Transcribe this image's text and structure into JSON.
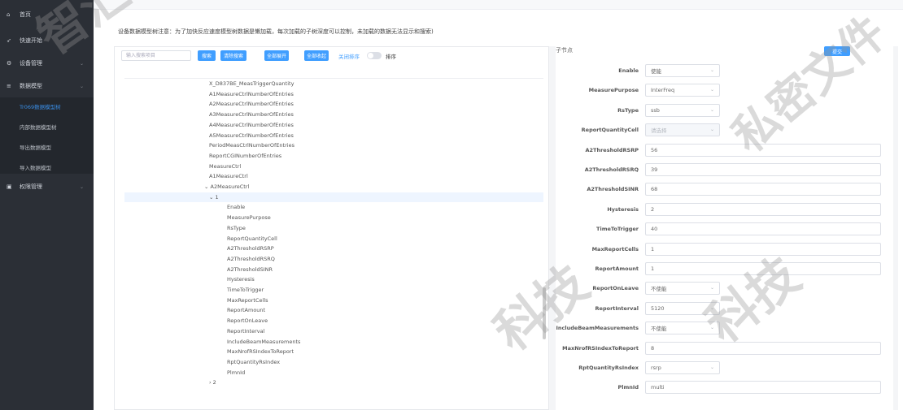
{
  "sidebar": {
    "items": [
      {
        "icon": "home-icon",
        "glyph": "⌂",
        "label": "首页"
      },
      {
        "icon": "rocket-icon",
        "glyph": "➶",
        "label": "快速开始"
      },
      {
        "icon": "gear-icon",
        "glyph": "⚙",
        "label": "设备管理"
      },
      {
        "icon": "list-icon",
        "glyph": "≡",
        "label": "数据模型"
      },
      {
        "icon": "id-card-icon",
        "glyph": "▣",
        "label": "权限管理"
      }
    ],
    "chevron": "⌄",
    "submenu": [
      "Tr069数据模型树",
      "内部数据模型树",
      "导出数据模型",
      "导入数据模型"
    ]
  },
  "notice": "设备数据模型树注意：为了加快反应速度模型树数据是懒加载，每次加载的子树深度可以控制，未加载的数据无法显示和搜索)",
  "toolbar": {
    "search_placeholder": "输入搜索项目",
    "search_btn": "搜索",
    "clear_btn": "清除搜索",
    "expand_btn": "全部展开",
    "collapse_btn": "全部收起",
    "close_sort": "关闭排序",
    "sort": "排序"
  },
  "tree": {
    "rows": [
      {
        "text": "X_D837BE_MeasTriggerQuantity"
      },
      {
        "text": "A1MeasureCtrlNumberOfEntries"
      },
      {
        "text": "A2MeasureCtrlNumberOfEntries"
      },
      {
        "text": "A3MeasureCtrlNumberOfEntries"
      },
      {
        "text": "A4MeasureCtrlNumberOfEntries"
      },
      {
        "text": "A5MeasureCtrlNumberOfEntries"
      },
      {
        "text": "PeriodMeasCtrlNumberOfEntries"
      },
      {
        "text": "ReportCGINumberOfEntries"
      },
      {
        "text": "MeasureCtrl"
      },
      {
        "text": "A1MeasureCtrl"
      },
      {
        "text": "⌄ A2MeasureCtrl"
      },
      {
        "text": "⌄ 1"
      },
      {
        "text": "Enable"
      },
      {
        "text": "MeasurePurpose"
      },
      {
        "text": "RsType"
      },
      {
        "text": "ReportQuantityCell"
      },
      {
        "text": "A2ThresholdRSRP"
      },
      {
        "text": "A2ThresholdRSRQ"
      },
      {
        "text": "A2ThresholdSINR"
      },
      {
        "text": "Hysteresis"
      },
      {
        "text": "TimeToTrigger"
      },
      {
        "text": "MaxReportCells"
      },
      {
        "text": "ReportAmount"
      },
      {
        "text": "ReportOnLeave"
      },
      {
        "text": "ReportInterval"
      },
      {
        "text": "IncludeBeamMeasurements"
      },
      {
        "text": "MaxNrofRSIndexToReport"
      },
      {
        "text": "RptQuantityRsIndex"
      },
      {
        "text": "PlmnId"
      },
      {
        "text": "› 2"
      }
    ]
  },
  "right": {
    "title": "子节点",
    "submit": "提交",
    "fields": [
      {
        "label": "Enable",
        "value": "使能",
        "select": true
      },
      {
        "label": "MeasurePurpose",
        "value": "InterFreq",
        "select": true
      },
      {
        "label": "RsType",
        "value": "ssb",
        "select": true
      },
      {
        "label": "ReportQuantityCell",
        "value": "请选择",
        "select": true,
        "disabled": true
      },
      {
        "label": "A2ThresholdRSRP",
        "value": "56"
      },
      {
        "label": "A2ThresholdRSRQ",
        "value": "39"
      },
      {
        "label": "A2ThresholdSINR",
        "value": "68"
      },
      {
        "label": "Hysteresis",
        "value": "2"
      },
      {
        "label": "TimeToTrigger",
        "value": "40"
      },
      {
        "label": "MaxReportCells",
        "value": "1"
      },
      {
        "label": "ReportAmount",
        "value": "1"
      },
      {
        "label": "ReportOnLeave",
        "value": "不使能",
        "select": true
      },
      {
        "label": "ReportInterval",
        "value": "5120",
        "select": true
      },
      {
        "label": "IncludeBeamMeasurements",
        "value": "不使能",
        "select": true
      },
      {
        "label": "MaxNrofRSIndexToReport",
        "value": "8"
      },
      {
        "label": "RptQuantityRsIndex",
        "value": "rsrp",
        "select": true
      },
      {
        "label": "PlmnId",
        "value": "multi"
      }
    ],
    "select_arrow": "⌄"
  },
  "watermarks": [
    "智汇",
    "私密文件",
    "科技",
    "科技",
    "私密文件"
  ]
}
